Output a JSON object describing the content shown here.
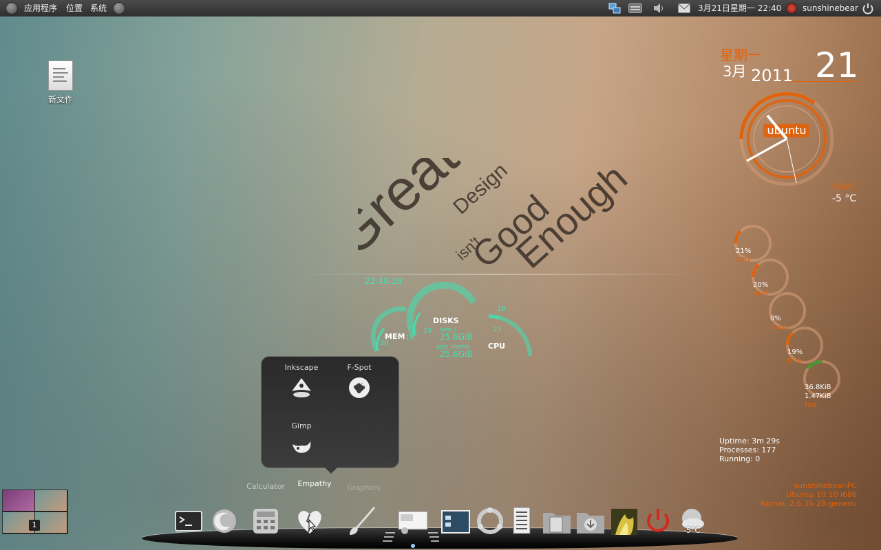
{
  "panel": {
    "menu_apps": "应用程序",
    "menu_places": "位置",
    "menu_system": "系统",
    "datetime": "3月21日星期一 22:40",
    "username": "sunshinebear"
  },
  "desktop": {
    "file_label": "新文件"
  },
  "wallpaper": {
    "word_great": "Great",
    "word_design": "Design",
    "word_isnt": "isn't",
    "word_good": "Good",
    "word_enough": "Enough"
  },
  "conky_left": {
    "time": "22:40:28",
    "mem_label": "MEM",
    "mem_value": "20",
    "disks_label": "DISKS",
    "disk_a_value": "19",
    "disk_b_value": "19",
    "disk_root_label": "size /",
    "disk_root_size": "25.6GiB",
    "disk_home_label": "size /home",
    "disk_home_size": "25.6GiB",
    "cpu_label": "CPU",
    "cpu_a": "18",
    "cpu_b": "21"
  },
  "conky_right": {
    "weekday": "星期一",
    "month": "3月",
    "year": "2011",
    "day": "21",
    "clock_brand": "ubuntu",
    "weather_city": "HOME",
    "weather_temp": "-5 °C",
    "rings": [
      {
        "value": "21%",
        "label": "CPU",
        "fraction": 0.21
      },
      {
        "value": "20%",
        "label": "RAM",
        "fraction": 0.2
      },
      {
        "value": "0%",
        "label": "Swap",
        "fraction": 0.0
      },
      {
        "value": "19%",
        "label": "Disk",
        "fraction": 0.19
      },
      {
        "value_up": "36.8KiB",
        "value_down": "1.47KiB",
        "label": "Net",
        "fraction": 0.15
      }
    ],
    "uptime": "Uptime: 3m 29s",
    "processes": "Processes: 177",
    "running": "Running: 0",
    "hostname": "sunshinebear-PC",
    "os": "Ubuntu 10.10  i686",
    "kernel": "Kernel: 2.6.35-28-generic"
  },
  "popup": {
    "items": [
      {
        "label": "Inkscape",
        "icon": "inkscape-icon"
      },
      {
        "label": "F-Spot",
        "icon": "f-spot-icon"
      },
      {
        "label": "Gimp",
        "icon": "gimp-icon"
      }
    ]
  },
  "dock": {
    "label_calculator": "Calculator",
    "label_empathy": "Empathy",
    "label_graphics": "Graphics",
    "weather_badge": "-5°C",
    "items": [
      "terminal-icon",
      "firefox-icon",
      "calculator-icon",
      "empathy-icon",
      "graphics-icon",
      "screenshot-icon",
      "window-icon",
      "ubuntu-icon",
      "list-icon",
      "documents-folder-icon",
      "downloads-folder-icon",
      "photo-icon",
      "power-icon",
      "weather-icon"
    ]
  },
  "workspace": {
    "current": "1"
  },
  "colors": {
    "accent": "#e2620a",
    "teal": "#3fe3b3"
  }
}
